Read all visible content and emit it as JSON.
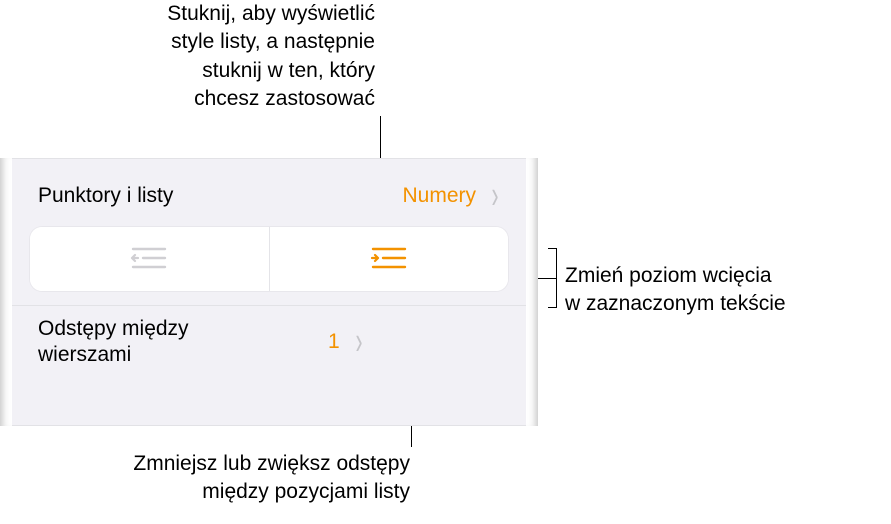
{
  "callouts": {
    "top": "Stuknij, aby wyświetlić\nstyle listy, a następnie\nstuknij w ten, który\nchcesz zastosować",
    "right": "Zmień poziom wcięcia\nw zaznaczonym tekście",
    "bottom": "Zmniejsz lub zwiększ odstępy\nmiędzy pozycjami listy"
  },
  "panel": {
    "bulletsLabel": "Punktory i listy",
    "bulletsValue": "Numery",
    "lineSpacingLabel": "Odstępy między\nwierszami",
    "lineSpacingValue": "1"
  },
  "colors": {
    "accent": "#f39200"
  }
}
